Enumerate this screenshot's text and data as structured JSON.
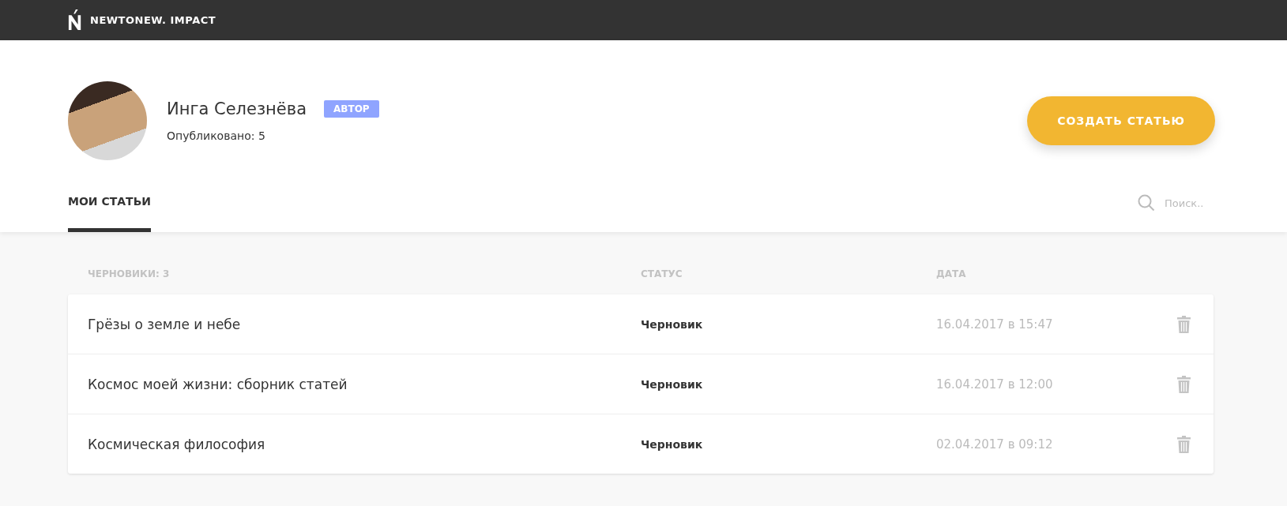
{
  "header": {
    "brand": "NEWTONEW. IMPACT"
  },
  "profile": {
    "name": "Инга Селезнёва",
    "role_badge": "АВТОР",
    "published": "Опубликовано: 5"
  },
  "create_button": "СОЗДАТЬ СТАТЬЮ",
  "tabs": [
    {
      "label": "МОИ СТАТЬИ",
      "selected": true
    }
  ],
  "search": {
    "placeholder": "Поиск.."
  },
  "table": {
    "columns": [
      "ЧЕРНОВИКИ: 3",
      "СТАТУС",
      "ДАТА"
    ],
    "rows": [
      {
        "title": "Грёзы о земле и небе",
        "status": "Черновик",
        "date": "16.04.2017 в 15:47"
      },
      {
        "title": "Космос моей жизни: сборник статей",
        "status": "Черновик",
        "date": "16.04.2017 в 12:00"
      },
      {
        "title": "Космическая философия",
        "status": "Черновик",
        "date": "02.04.2017 в 09:12"
      }
    ]
  }
}
